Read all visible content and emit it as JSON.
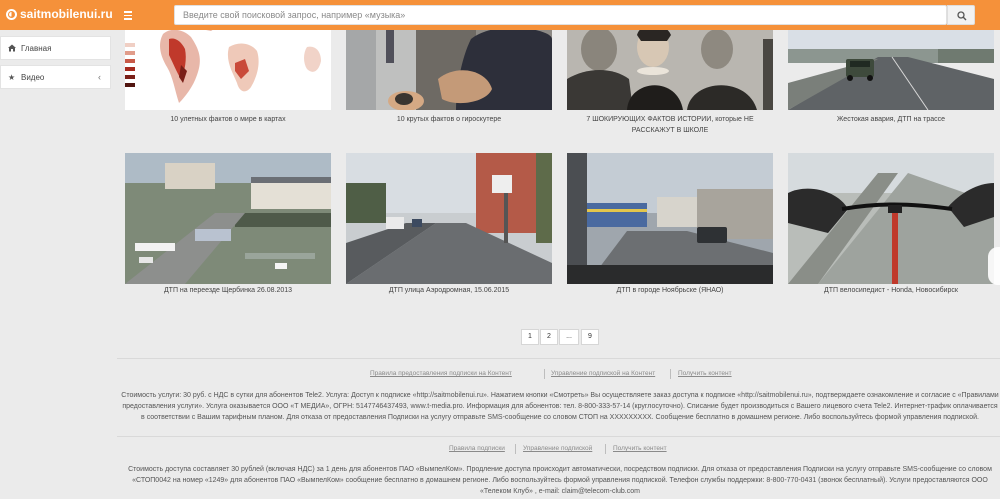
{
  "header": {
    "logo_text": "saitmobilenui.ru",
    "logo_suffix": ".ru",
    "search_placeholder": "Введите свой поисковой запрос, например «музыка»",
    "accent_color": "#f5913a",
    "menu_icon": "hamburger-icon",
    "search_icon": "magnifier-icon"
  },
  "sidebar": {
    "items": [
      {
        "label": "Главная",
        "icon": "home-icon"
      },
      {
        "label": "Видео",
        "icon": "star-icon",
        "chevron": "‹"
      }
    ]
  },
  "videos": [
    {
      "title": "10 улетных фактов о мире в картах"
    },
    {
      "title": "10 крутых фактов о гироскутере"
    },
    {
      "title": "7 ШОКИРУЮЩИХ ФАКТОВ ИСТОРИИ, которые НЕ РАССКАЖУТ В ШКОЛЕ"
    },
    {
      "title": "Жестокая авария, ДТП на трассе"
    },
    {
      "title": "ДТП на переезде Щербинка 26.08.2013"
    },
    {
      "title": "ДТП улица Аэродромная, 15.06.2015"
    },
    {
      "title": "ДТП в городе Ноябрьске (ЯНАО)"
    },
    {
      "title": "ДТП велосипедист - Honda, Новосибирск"
    }
  ],
  "pagination": {
    "pages": [
      "1",
      "2",
      "...",
      "9"
    ]
  },
  "footer": {
    "links1": [
      "Правила предоставления подписки на Контент",
      "Управление подпиской на Контент",
      "Получить контент"
    ],
    "text1": "Стоимость услуги: 30 руб. с НДС в сутки для абонентов Tele2. Услуга: Доступ к подписке «http://saitmobilenui.ru». Нажатием кнопки «Смотреть» Вы осуществляете заказ доступа к подписке «http://saitmobilenui.ru», подтверждаете ознакомление и согласие с «Правилами предоставления услуги». Услуга оказывается ООО «Т МЕДИА», ОГРН: 5147746437493, www.t-media.pro. Информация для абонентов: тел. 8-800-333-57-14 (круглосуточно). Списание будет производиться с Вашего лицевого счета Tele2. Интернет-трафик оплачивается в соответствии с Вашим тарифным планом. Для отказа от предоставления Подписки на услугу отправьте SMS-сообщение со словом СТОП на XXXXXXXXX. Сообщение бесплатно в домашнем регионе. Либо воспользуйтесь формой управления подпиской.",
    "links2": [
      "Правила подписки",
      "Управление подпиской",
      "Получить контент"
    ],
    "text2": "Стоимость доступа составляет 30 рублей (включая НДС) за 1 день для абонентов ПАО «ВымпелКом». Продление доступа происходит автоматически, посредством подписки. Для отказа от предоставления Подписки на услугу отправьте SMS-сообщение со словом «СТОП0042 на номер «1249» для абонентов ПАО «ВымпелКом» сообщение бесплатно в домашнем регионе. Либо воспользуйтесь формой управления подпиской. Телефон службы поддержки: 8-800-770-0431 (звонок бесплатный). Услуги предоставляются ООО «Телеком Клуб» , e-mail: claim@telecom-club.com"
  }
}
